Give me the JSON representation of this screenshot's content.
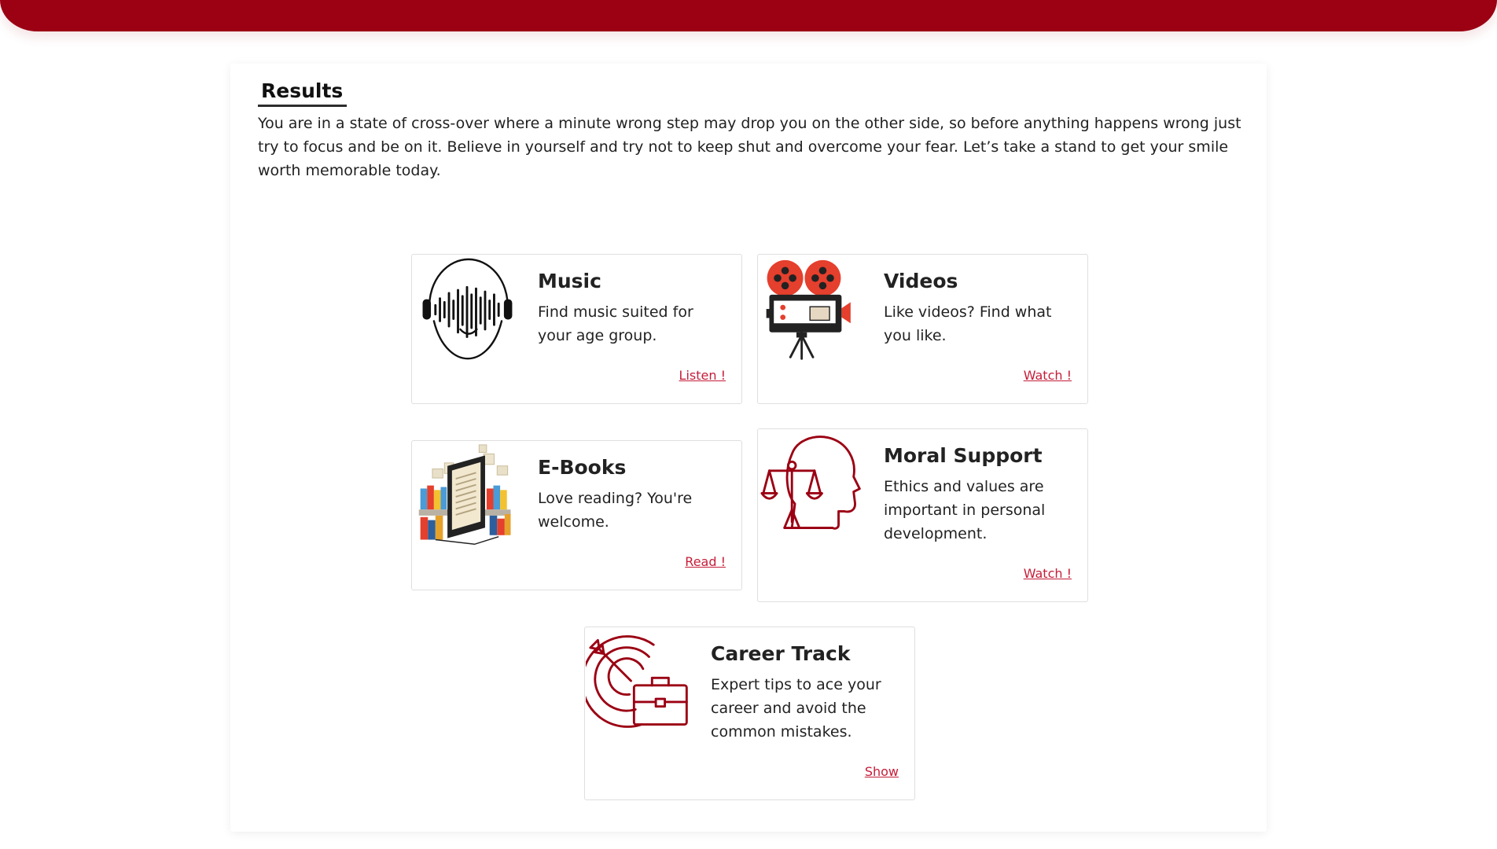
{
  "colors": {
    "header": "#9b0013",
    "link": "#c51d38",
    "icon_red": "#9b0013",
    "reel_red": "#e53f2d"
  },
  "results": {
    "title": "Results",
    "description": "You are in a state of cross-over where a minute wrong step may drop you on the other side, so before anything happens wrong just try to focus and be on it. Believe in yourself and try not to keep shut and overcome your fear. Let’s take a stand to get your smile worth memorable today."
  },
  "cards": {
    "music": {
      "title": "Music",
      "text": "Find music suited for your age group.",
      "link": "Listen !",
      "icon": "headphones-soundwave-icon"
    },
    "videos": {
      "title": "Videos",
      "text": "Like videos? Find what you like.",
      "link": "Watch !",
      "icon": "film-camera-icon"
    },
    "ebooks": {
      "title": "E-Books",
      "text": "Love reading? You're welcome.",
      "link": "Read !",
      "icon": "ebook-reader-icon"
    },
    "moral": {
      "title": "Moral Support",
      "text": "Ethics and values are important in personal development.",
      "link": "Watch !",
      "icon": "head-scales-icon"
    },
    "career": {
      "title": "Career Track",
      "text": "Expert tips to ace your career and avoid the common mistakes.",
      "link": "Show",
      "icon": "target-briefcase-icon"
    }
  }
}
